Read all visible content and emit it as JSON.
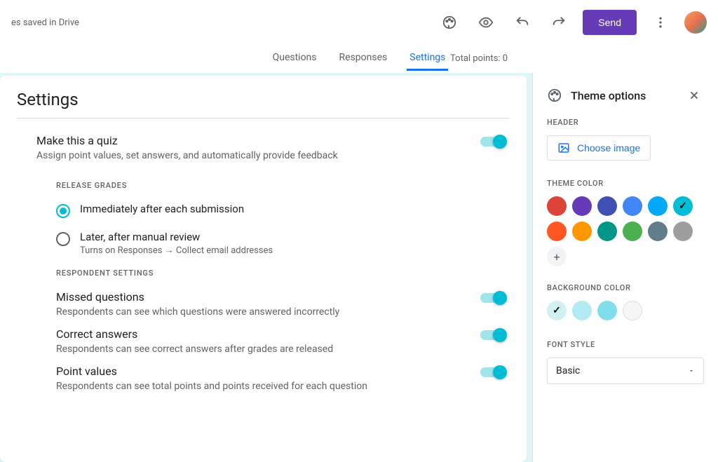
{
  "header": {
    "save_status": "es saved in Drive",
    "send_label": "Send"
  },
  "tabs": {
    "questions": "Questions",
    "responses": "Responses",
    "settings": "Settings",
    "total_points": "Total points: 0"
  },
  "settings": {
    "title": "Settings",
    "quiz": {
      "title": "Make this a quiz",
      "subtitle": "Assign point values, set answers, and automatically provide feedback"
    },
    "release_grades_label": "RELEASE GRADES",
    "release_options": {
      "immediate": "Immediately after each submission",
      "later": "Later, after manual review",
      "later_sub": "Turns on Responses → Collect email addresses"
    },
    "respondent_label": "RESPONDENT SETTINGS",
    "missed": {
      "title": "Missed questions",
      "sub": "Respondents can see which questions were answered incorrectly"
    },
    "correct": {
      "title": "Correct answers",
      "sub": "Respondents can see correct answers after grades are released"
    },
    "points": {
      "title": "Point values",
      "sub": "Respondents can see total points and points received for each question"
    }
  },
  "panel": {
    "title": "Theme options",
    "header_label": "HEADER",
    "choose_image": "Choose image",
    "theme_color_label": "THEME COLOR",
    "theme_colors": [
      "#db4437",
      "#673ab7",
      "#3f51b5",
      "#4285f4",
      "#03a9f4",
      "#00bcd4",
      "#ff5722",
      "#ff9800",
      "#009688",
      "#4caf50",
      "#607d8b",
      "#9e9e9e"
    ],
    "theme_selected_index": 5,
    "bg_label": "BACKGROUND COLOR",
    "bg_colors": [
      "#d0f0f2",
      "#b2ebf2",
      "#80deea",
      "#f6f6f6"
    ],
    "bg_selected_index": 0,
    "font_label": "FONT STYLE",
    "font_value": "Basic"
  }
}
